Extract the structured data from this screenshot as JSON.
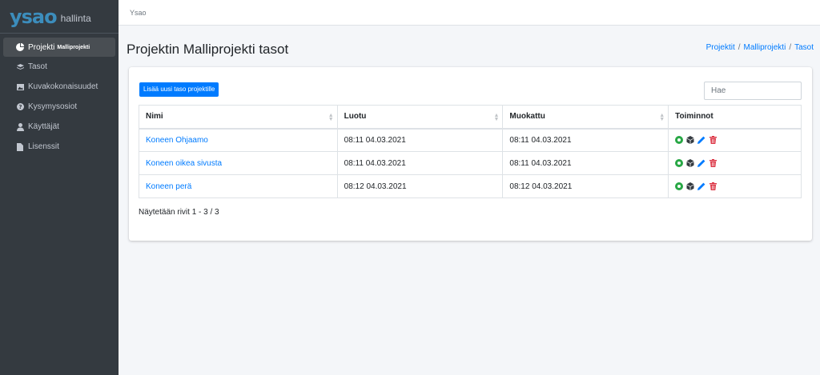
{
  "brand": {
    "logo": "ysao",
    "text": "hallinta"
  },
  "sidebar": {
    "items": [
      {
        "label": "Projekti",
        "sub": "Malliprojekti",
        "icon": "pie-chart-icon",
        "active": true
      },
      {
        "label": "Tasot",
        "icon": "layers-icon"
      },
      {
        "label": "Kuvakokonaisuudet",
        "icon": "images-icon"
      },
      {
        "label": "Kysymysosiot",
        "icon": "question-circle-icon"
      },
      {
        "label": "Käyttäjät",
        "icon": "user-icon"
      },
      {
        "label": "Lisenssit",
        "icon": "file-icon"
      }
    ]
  },
  "topbar": {
    "title": "Ysao"
  },
  "page": {
    "title": "Projektin Malliprojekti tasot",
    "breadcrumb": [
      "Projektit",
      "Malliprojekti",
      "Tasot"
    ],
    "breadcrumb_sep": "/"
  },
  "card": {
    "add_button": "Lisää uusi taso projektille",
    "search_placeholder": "Hae",
    "columns": [
      "Nimi",
      "Luotu",
      "Muokattu",
      "Toiminnot"
    ],
    "rows": [
      {
        "name": "Koneen Ohjaamo",
        "created": "08:11 04.03.2021",
        "modified": "08:11 04.03.2021"
      },
      {
        "name": "Koneen oikea sivusta",
        "created": "08:11 04.03.2021",
        "modified": "08:11 04.03.2021"
      },
      {
        "name": "Koneen perä",
        "created": "08:12 04.03.2021",
        "modified": "08:12 04.03.2021"
      }
    ],
    "status": "Näytetään rivit 1 - 3 / 3"
  },
  "colors": {
    "accent": "#007bff",
    "sidebar": "#343a40",
    "success": "#28a745",
    "danger": "#dc3545",
    "dark": "#343a40"
  }
}
